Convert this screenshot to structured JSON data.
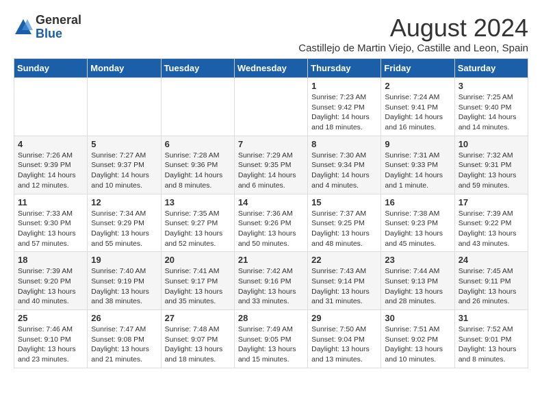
{
  "logo": {
    "general": "General",
    "blue": "Blue"
  },
  "title": {
    "month_year": "August 2024",
    "location": "Castillejo de Martin Viejo, Castille and Leon, Spain"
  },
  "days_of_week": [
    "Sunday",
    "Monday",
    "Tuesday",
    "Wednesday",
    "Thursday",
    "Friday",
    "Saturday"
  ],
  "weeks": [
    [
      {
        "day": "",
        "info": ""
      },
      {
        "day": "",
        "info": ""
      },
      {
        "day": "",
        "info": ""
      },
      {
        "day": "",
        "info": ""
      },
      {
        "day": "1",
        "info": "Sunrise: 7:23 AM\nSunset: 9:42 PM\nDaylight: 14 hours\nand 18 minutes."
      },
      {
        "day": "2",
        "info": "Sunrise: 7:24 AM\nSunset: 9:41 PM\nDaylight: 14 hours\nand 16 minutes."
      },
      {
        "day": "3",
        "info": "Sunrise: 7:25 AM\nSunset: 9:40 PM\nDaylight: 14 hours\nand 14 minutes."
      }
    ],
    [
      {
        "day": "4",
        "info": "Sunrise: 7:26 AM\nSunset: 9:39 PM\nDaylight: 14 hours\nand 12 minutes."
      },
      {
        "day": "5",
        "info": "Sunrise: 7:27 AM\nSunset: 9:37 PM\nDaylight: 14 hours\nand 10 minutes."
      },
      {
        "day": "6",
        "info": "Sunrise: 7:28 AM\nSunset: 9:36 PM\nDaylight: 14 hours\nand 8 minutes."
      },
      {
        "day": "7",
        "info": "Sunrise: 7:29 AM\nSunset: 9:35 PM\nDaylight: 14 hours\nand 6 minutes."
      },
      {
        "day": "8",
        "info": "Sunrise: 7:30 AM\nSunset: 9:34 PM\nDaylight: 14 hours\nand 4 minutes."
      },
      {
        "day": "9",
        "info": "Sunrise: 7:31 AM\nSunset: 9:33 PM\nDaylight: 14 hours\nand 1 minute."
      },
      {
        "day": "10",
        "info": "Sunrise: 7:32 AM\nSunset: 9:31 PM\nDaylight: 13 hours\nand 59 minutes."
      }
    ],
    [
      {
        "day": "11",
        "info": "Sunrise: 7:33 AM\nSunset: 9:30 PM\nDaylight: 13 hours\nand 57 minutes."
      },
      {
        "day": "12",
        "info": "Sunrise: 7:34 AM\nSunset: 9:29 PM\nDaylight: 13 hours\nand 55 minutes."
      },
      {
        "day": "13",
        "info": "Sunrise: 7:35 AM\nSunset: 9:27 PM\nDaylight: 13 hours\nand 52 minutes."
      },
      {
        "day": "14",
        "info": "Sunrise: 7:36 AM\nSunset: 9:26 PM\nDaylight: 13 hours\nand 50 minutes."
      },
      {
        "day": "15",
        "info": "Sunrise: 7:37 AM\nSunset: 9:25 PM\nDaylight: 13 hours\nand 48 minutes."
      },
      {
        "day": "16",
        "info": "Sunrise: 7:38 AM\nSunset: 9:23 PM\nDaylight: 13 hours\nand 45 minutes."
      },
      {
        "day": "17",
        "info": "Sunrise: 7:39 AM\nSunset: 9:22 PM\nDaylight: 13 hours\nand 43 minutes."
      }
    ],
    [
      {
        "day": "18",
        "info": "Sunrise: 7:39 AM\nSunset: 9:20 PM\nDaylight: 13 hours\nand 40 minutes."
      },
      {
        "day": "19",
        "info": "Sunrise: 7:40 AM\nSunset: 9:19 PM\nDaylight: 13 hours\nand 38 minutes."
      },
      {
        "day": "20",
        "info": "Sunrise: 7:41 AM\nSunset: 9:17 PM\nDaylight: 13 hours\nand 35 minutes."
      },
      {
        "day": "21",
        "info": "Sunrise: 7:42 AM\nSunset: 9:16 PM\nDaylight: 13 hours\nand 33 minutes."
      },
      {
        "day": "22",
        "info": "Sunrise: 7:43 AM\nSunset: 9:14 PM\nDaylight: 13 hours\nand 31 minutes."
      },
      {
        "day": "23",
        "info": "Sunrise: 7:44 AM\nSunset: 9:13 PM\nDaylight: 13 hours\nand 28 minutes."
      },
      {
        "day": "24",
        "info": "Sunrise: 7:45 AM\nSunset: 9:11 PM\nDaylight: 13 hours\nand 26 minutes."
      }
    ],
    [
      {
        "day": "25",
        "info": "Sunrise: 7:46 AM\nSunset: 9:10 PM\nDaylight: 13 hours\nand 23 minutes."
      },
      {
        "day": "26",
        "info": "Sunrise: 7:47 AM\nSunset: 9:08 PM\nDaylight: 13 hours\nand 21 minutes."
      },
      {
        "day": "27",
        "info": "Sunrise: 7:48 AM\nSunset: 9:07 PM\nDaylight: 13 hours\nand 18 minutes."
      },
      {
        "day": "28",
        "info": "Sunrise: 7:49 AM\nSunset: 9:05 PM\nDaylight: 13 hours\nand 15 minutes."
      },
      {
        "day": "29",
        "info": "Sunrise: 7:50 AM\nSunset: 9:04 PM\nDaylight: 13 hours\nand 13 minutes."
      },
      {
        "day": "30",
        "info": "Sunrise: 7:51 AM\nSunset: 9:02 PM\nDaylight: 13 hours\nand 10 minutes."
      },
      {
        "day": "31",
        "info": "Sunrise: 7:52 AM\nSunset: 9:01 PM\nDaylight: 13 hours\nand 8 minutes."
      }
    ]
  ]
}
